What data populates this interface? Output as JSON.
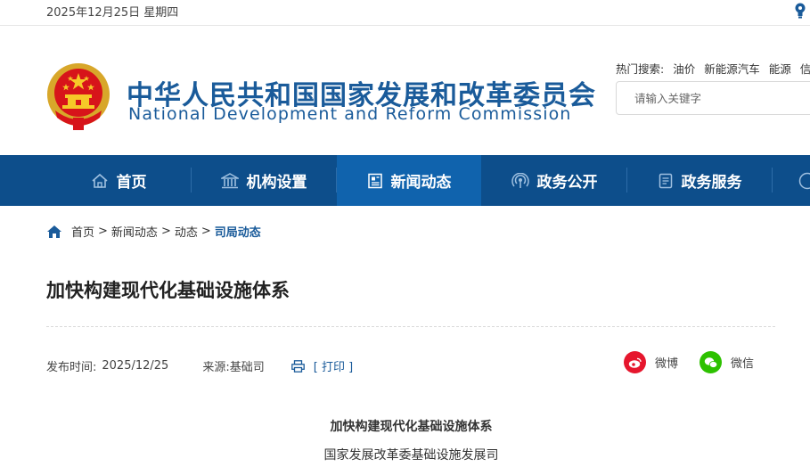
{
  "topbar": {
    "date": "2025年12月25日 星期四"
  },
  "header": {
    "title_cn": "中华人民共和国国家发展和改革委员会",
    "title_en": "National Development and Reform Commission"
  },
  "search": {
    "hot_label": "热门搜索:",
    "hot_terms": [
      "油价",
      "新能源汽车",
      "能源",
      "信"
    ],
    "placeholder": "请输入关键字"
  },
  "nav": {
    "items": [
      {
        "label": "首页",
        "icon": "home-icon"
      },
      {
        "label": "机构设置",
        "icon": "institution-icon"
      },
      {
        "label": "新闻动态",
        "icon": "news-icon",
        "active": true
      },
      {
        "label": "政务公开",
        "icon": "broadcast-icon"
      },
      {
        "label": "政务服务",
        "icon": "document-icon"
      }
    ]
  },
  "breadcrumb": {
    "items": [
      "首页",
      "新闻动态",
      "动态",
      "司局动态"
    ],
    "separator": ">"
  },
  "article": {
    "title": "加快构建现代化基础设施体系",
    "publish_label": "发布时间:",
    "publish_date": "2025/12/25",
    "source_label": "来源:",
    "source": "基础司",
    "print_label": "[ 打印 ]",
    "share": [
      {
        "label": "微博",
        "icon": "weibo-icon",
        "color": "#e6162d"
      },
      {
        "label": "微信",
        "icon": "wechat-icon",
        "color": "#2dc100"
      }
    ],
    "body_title": "加快构建现代化基础设施体系",
    "body_subtitle": "国家发展改革委基础设施发展司"
  },
  "colors": {
    "brand_blue": "#0d4e8b",
    "nav_active": "#1063ad",
    "title_blue": "#1a5b9a"
  }
}
